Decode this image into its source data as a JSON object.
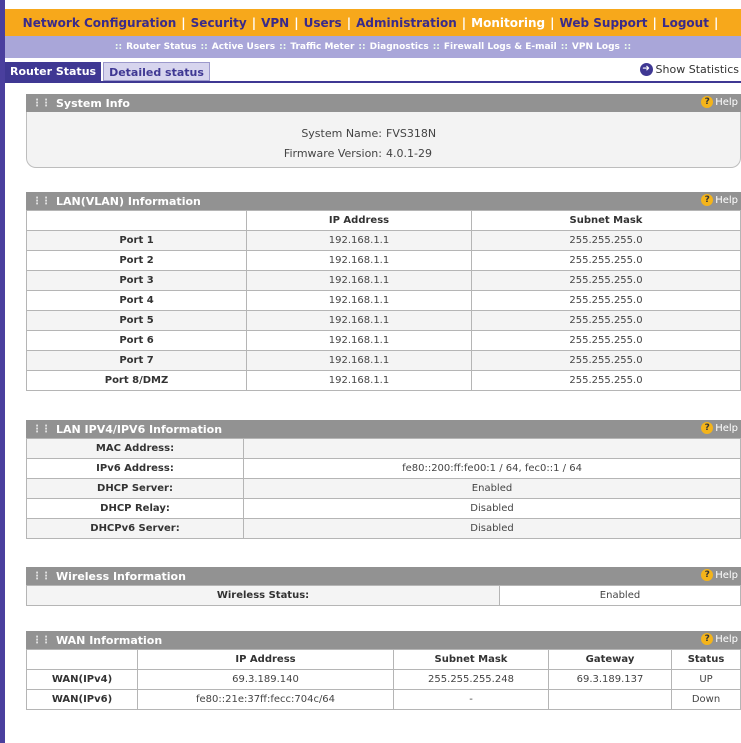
{
  "nav": {
    "items": [
      "Network Configuration",
      "Security",
      "VPN",
      "Users",
      "Administration",
      "Monitoring",
      "Web Support",
      "Logout"
    ],
    "active_index": 5,
    "separator": "|"
  },
  "subnav": {
    "items": [
      "Router Status",
      "Active Users",
      "Traffic Meter",
      "Diagnostics",
      "Firewall Logs & E-mail",
      "VPN Logs"
    ],
    "separator": "::"
  },
  "tabs": {
    "router_status": "Router Status",
    "detailed_status": "Detailed status"
  },
  "show_statistics": "Show Statistics",
  "help_label": "Help",
  "system_info": {
    "title": "System Info",
    "name_label": "System Name:",
    "name_value": "FVS318N",
    "fw_label": "Firmware Version:",
    "fw_value": "4.0.1-29"
  },
  "lan_vlan": {
    "title": "LAN(VLAN) Information",
    "columns": [
      "",
      "IP Address",
      "Subnet Mask"
    ],
    "rows": [
      [
        "Port 1",
        "192.168.1.1",
        "255.255.255.0"
      ],
      [
        "Port 2",
        "192.168.1.1",
        "255.255.255.0"
      ],
      [
        "Port 3",
        "192.168.1.1",
        "255.255.255.0"
      ],
      [
        "Port 4",
        "192.168.1.1",
        "255.255.255.0"
      ],
      [
        "Port 5",
        "192.168.1.1",
        "255.255.255.0"
      ],
      [
        "Port 6",
        "192.168.1.1",
        "255.255.255.0"
      ],
      [
        "Port 7",
        "192.168.1.1",
        "255.255.255.0"
      ],
      [
        "Port 8/DMZ",
        "192.168.1.1",
        "255.255.255.0"
      ]
    ]
  },
  "lan_ip": {
    "title": "LAN IPV4/IPV6 Information",
    "rows": [
      [
        "MAC Address:",
        ""
      ],
      [
        "IPv6 Address:",
        "fe80::200:ff:fe00:1 / 64, fec0::1 / 64"
      ],
      [
        "DHCP Server:",
        "Enabled"
      ],
      [
        "DHCP Relay:",
        "Disabled"
      ],
      [
        "DHCPv6 Server:",
        "Disabled"
      ]
    ]
  },
  "wireless": {
    "title": "Wireless Information",
    "status_label": "Wireless Status:",
    "status_value": "Enabled"
  },
  "wan": {
    "title": "WAN Information",
    "columns": [
      "",
      "IP Address",
      "Subnet Mask",
      "Gateway",
      "Status"
    ],
    "rows": [
      [
        "WAN(IPv4)",
        "69.3.189.140",
        "255.255.255.248",
        "69.3.189.137",
        "UP"
      ],
      [
        "WAN(IPv6)",
        "fe80::21e:37ff:fecc:704c/64",
        "-",
        "",
        "Down"
      ]
    ]
  }
}
